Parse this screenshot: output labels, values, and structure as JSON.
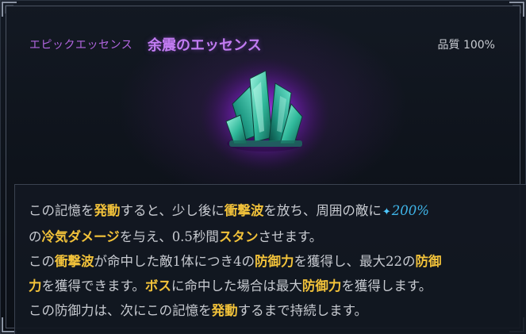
{
  "tooltip": {
    "rarity": "エピックエッセンス",
    "name": "余震のエッセンス",
    "quality": "品質 100%",
    "icon": "green-crystal-cluster-icon",
    "colors": {
      "rarity": "#b266e0",
      "name": "#c27cf2",
      "keyword": "#f2c23a",
      "percent": "#3fb4e8",
      "glow": "#8a2bd0"
    }
  },
  "description": {
    "l1_a": "この記憶を",
    "l1_kw1": "発動",
    "l1_b": "すると、少し後に",
    "l1_kw2": "衝撃波",
    "l1_c": "を放ち、周囲の敵に",
    "l1_icon": "✦",
    "l1_pct": "200%",
    "l2_a": "の",
    "l2_kw1": "冷気ダメージ",
    "l2_b": "を与え、0.5秒間",
    "l2_kw2": "スタン",
    "l2_c": "させます。",
    "l3_a": "この",
    "l3_kw1": "衝撃波",
    "l3_b": "が命中した敵1体につき4の",
    "l3_kw2": "防御力",
    "l3_c": "を獲得し、最大22の",
    "l3_kw3": "防御",
    "l4_kw0": "力",
    "l4_a": "を獲得できます。",
    "l4_kw1": "ボス",
    "l4_b": "に命中した場合は最大",
    "l4_kw2": "防御力",
    "l4_c": "を獲得します。",
    "l5_a": "この防御力は、次にこの記憶を",
    "l5_kw1": "発動",
    "l5_b": "するまで持続します。"
  }
}
